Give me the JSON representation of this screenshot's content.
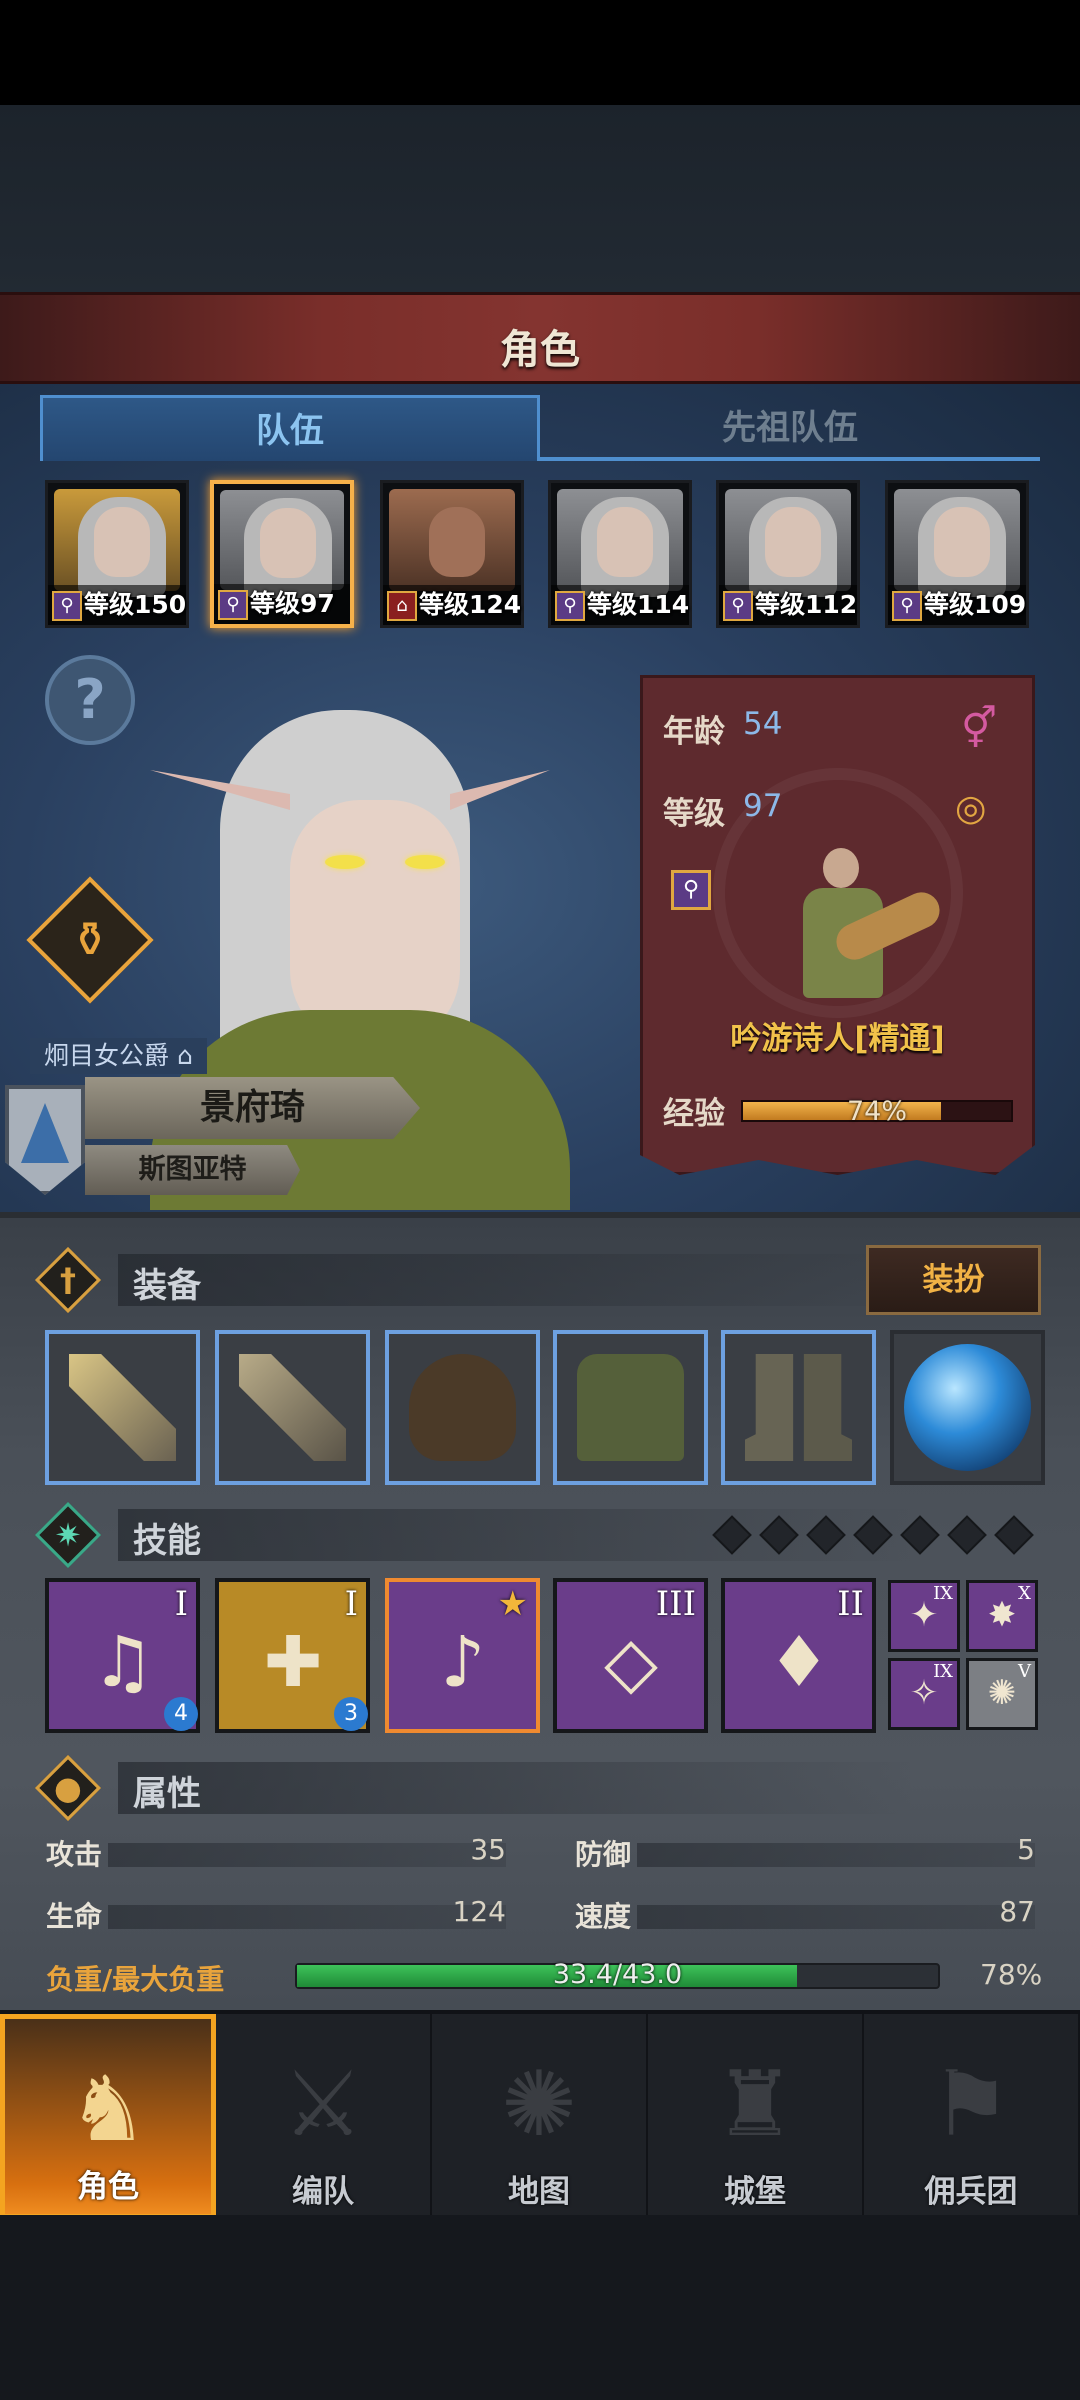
{
  "header": {
    "title": "角色"
  },
  "tabs": [
    {
      "label": "队伍"
    },
    {
      "label": "先祖队伍"
    }
  ],
  "party": [
    {
      "level_text": "等级150",
      "class_icon": "staff-icon"
    },
    {
      "level_text": "等级97",
      "class_icon": "staff-icon"
    },
    {
      "level_text": "等级124",
      "class_icon": "house-icon"
    },
    {
      "level_text": "等级114",
      "class_icon": "staff-icon"
    },
    {
      "level_text": "等级112",
      "class_icon": "staff-icon"
    },
    {
      "level_text": "等级109",
      "class_icon": "staff-icon"
    }
  ],
  "character": {
    "title": "炯目女公爵",
    "name": "景府琦",
    "region": "斯图亚特"
  },
  "info": {
    "age_label": "年龄",
    "age": "54",
    "level_label": "等级",
    "level": "97",
    "class_name": "吟游诗人[精通]",
    "exp_label": "经验",
    "exp_text": "74%",
    "exp_fraction": 0.74
  },
  "equipment": {
    "label": "装备",
    "dress_button": "装扮"
  },
  "skills": {
    "label": "技能",
    "slot_count": 7,
    "items": [
      {
        "roman": "I",
        "badge": "4",
        "glyph": "♫"
      },
      {
        "roman": "I",
        "badge": "3",
        "glyph": "✚"
      },
      {
        "roman": "",
        "badge": "",
        "glyph": "♪"
      },
      {
        "roman": "III",
        "badge": "",
        "glyph": "◇"
      },
      {
        "roman": "II",
        "badge": "",
        "glyph": "♦"
      }
    ],
    "mini": [
      {
        "roman": "IX",
        "glyph": "✦"
      },
      {
        "roman": "X",
        "glyph": "✸"
      },
      {
        "roman": "IX",
        "glyph": "✧"
      },
      {
        "roman": "V",
        "glyph": "✺"
      }
    ]
  },
  "attributes": {
    "label": "属性",
    "attack_label": "攻击",
    "attack": "35",
    "defense_label": "防御",
    "defense": "5",
    "hp_label": "生命",
    "hp": "124",
    "speed_label": "速度",
    "speed": "87",
    "weight_label": "负重/最大负重",
    "weight_text": "33.4/43.0",
    "weight_pct": "78%",
    "weight_fraction": 0.78
  },
  "nav": [
    {
      "label": "角色",
      "icon": "knight-icon"
    },
    {
      "label": "编队",
      "icon": "formation-icon"
    },
    {
      "label": "地图",
      "icon": "compass-icon"
    },
    {
      "label": "城堡",
      "icon": "castle-icon"
    },
    {
      "label": "佣兵团",
      "icon": "mercenary-icon"
    }
  ],
  "colors": {
    "accent": "#f4a420",
    "tab_blue": "#4f8fcf",
    "weight_green": "#3ec35a",
    "class_gold": "#f1c24a"
  }
}
